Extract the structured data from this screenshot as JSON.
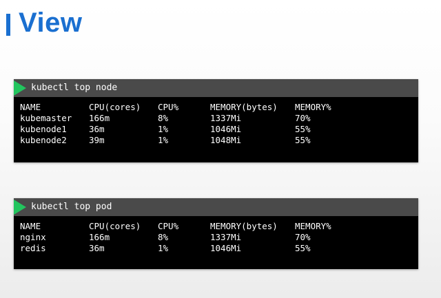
{
  "page": {
    "title": "View"
  },
  "top_node": {
    "command": "kubectl top node",
    "columns": [
      "NAME",
      "CPU(cores)",
      "CPU%",
      "MEMORY(bytes)",
      "MEMORY%"
    ],
    "rows": [
      [
        "kubemaster",
        "166m",
        "8%",
        "1337Mi",
        "70%"
      ],
      [
        "kubenode1",
        "36m",
        "1%",
        "1046Mi",
        "55%"
      ],
      [
        "kubenode2",
        "39m",
        "1%",
        "1048Mi",
        "55%"
      ]
    ]
  },
  "top_pod": {
    "command": "kubectl top pod",
    "columns": [
      "NAME",
      "CPU(cores)",
      "CPU%",
      "MEMORY(bytes)",
      "MEMORY%"
    ],
    "rows": [
      [
        "nginx",
        "166m",
        "8%",
        "1337Mi",
        "70%"
      ],
      [
        "redis",
        "36m",
        "1%",
        "1046Mi",
        "55%"
      ]
    ]
  },
  "colors": {
    "accent": "#1a6fd0",
    "play": "#22c55e",
    "terminal_bg": "#000000",
    "terminal_header": "#4a4a4a"
  },
  "icons": {
    "run": "play-icon"
  }
}
